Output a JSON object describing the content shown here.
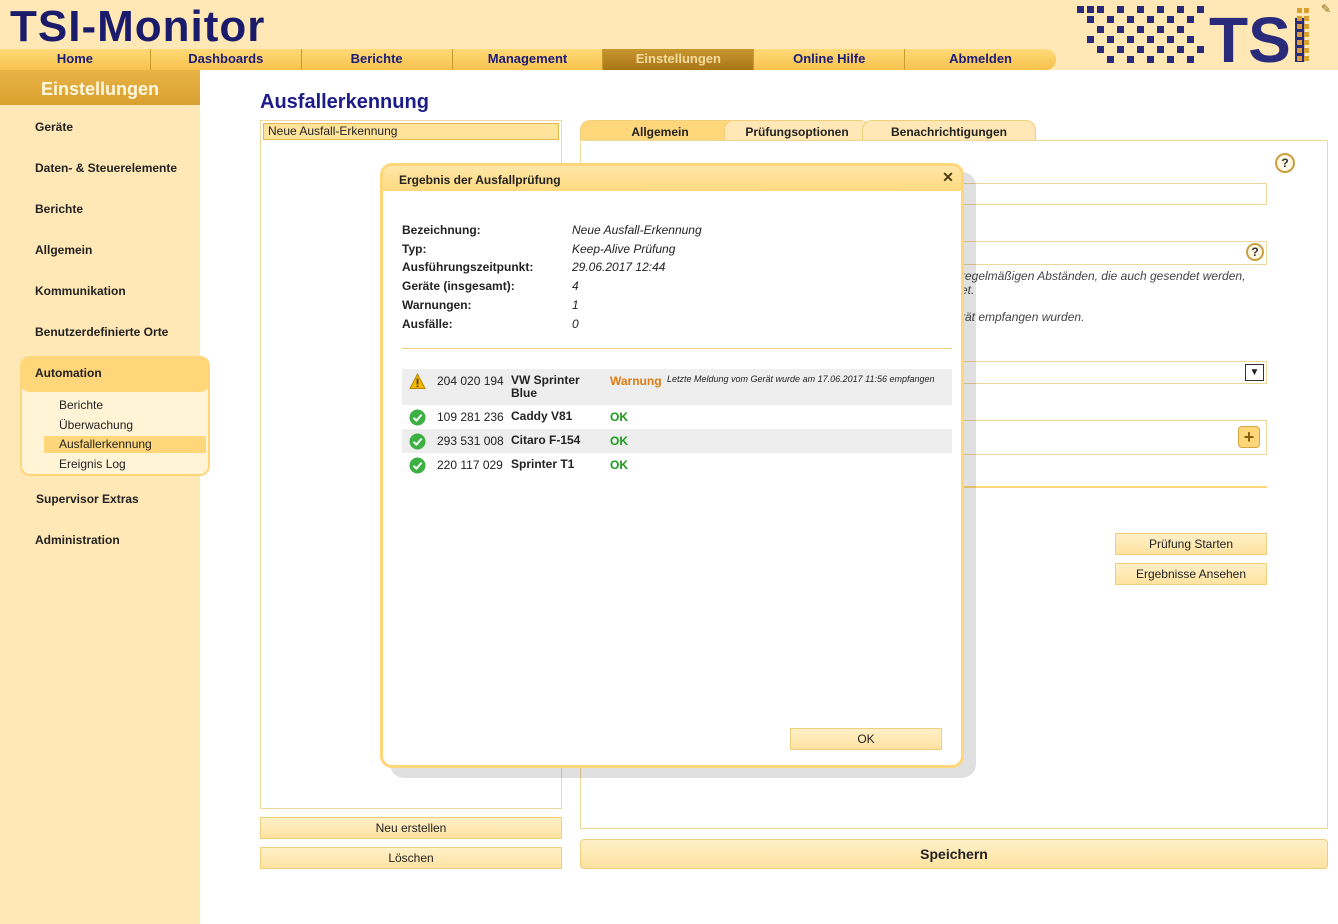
{
  "app": {
    "title": "TSI-Monitor",
    "logo_text": "TSI"
  },
  "nav": {
    "items": [
      "Home",
      "Dashboards",
      "Berichte",
      "Management",
      "Einstellungen",
      "Online Hilfe",
      "Abmelden"
    ],
    "active": "Einstellungen"
  },
  "sidebar": {
    "title": "Einstellungen",
    "items": [
      "Geräte",
      "Daten- & Steuerelemente",
      "Berichte",
      "Allgemein",
      "Kommunikation",
      "Benutzerdefinierte Orte",
      "Automation",
      "Supervisor Extras",
      "Administration"
    ],
    "automation_sub": [
      "Berichte",
      "Überwachung",
      "Ausfallerkennung",
      "Ereignis Log"
    ],
    "selected_sub": "Ausfallerkennung"
  },
  "main": {
    "title": "Ausfallerkennung",
    "list": {
      "selected_item": "Neue Ausfall-Erkennung"
    },
    "buttons": {
      "new": "Neu erstellen",
      "delete": "Löschen",
      "save": "Speichern",
      "start_check": "Prüfung Starten",
      "view_results": "Ergebnisse Ansehen"
    },
    "tabs": [
      "Allgemein",
      "Prüfungsoptionen",
      "Benachrichtigungen"
    ],
    "active_tab": "Allgemein",
    "partial_text": {
      "line1": "regelmäßigen Abständen, die auch gesendet werden,",
      "line2": "et.",
      "line3": "rät empfangen wurden."
    }
  },
  "modal": {
    "title": "Ergebnis der Ausfallprüfung",
    "info": [
      {
        "label": "Bezeichnung:",
        "value": "Neue Ausfall-Erkennung"
      },
      {
        "label": "Typ:",
        "value": "Keep-Alive Prüfung"
      },
      {
        "label": "Ausführungszeitpunkt:",
        "value": "29.06.2017 12:44"
      },
      {
        "label": "Geräte (insgesamt):",
        "value": "4"
      },
      {
        "label": "Warnungen:",
        "value": "1"
      },
      {
        "label": "Ausfälle:",
        "value": "0"
      }
    ],
    "results": [
      {
        "icon": "warning-icon",
        "number": "204 020 194",
        "name": "VW Sprinter Blue",
        "status": "Warnung",
        "message": "Letzte Meldung vom Gerät wurde am 17.06.2017 11:56 empfangen"
      },
      {
        "icon": "check-icon",
        "number": "109 281 236",
        "name": "Caddy V81",
        "status": "OK",
        "message": ""
      },
      {
        "icon": "check-icon",
        "number": "293 531 008",
        "name": "Citaro F-154",
        "status": "OK",
        "message": ""
      },
      {
        "icon": "check-icon",
        "number": "220 117 029",
        "name": "Sprinter T1",
        "status": "OK",
        "message": ""
      }
    ],
    "ok_button": "OK"
  },
  "colors": {
    "accent": "#ffd67a",
    "nav_text": "#1b1b7a",
    "title": "#1b1b8a",
    "ok": "#1a9a1a",
    "warn": "#e07a10"
  }
}
